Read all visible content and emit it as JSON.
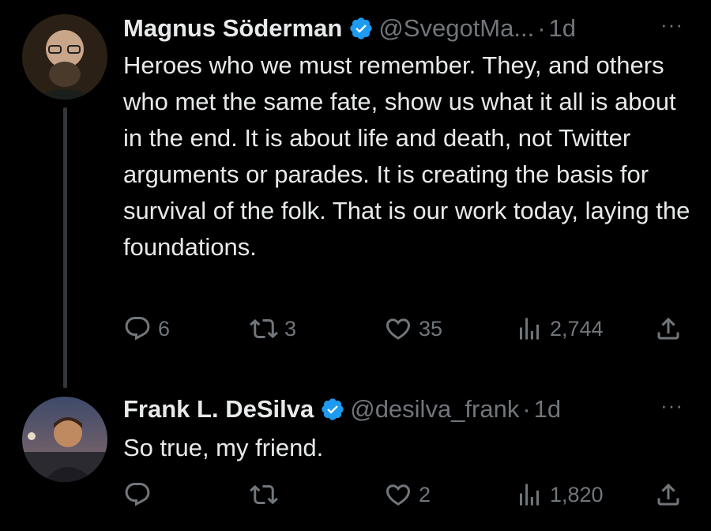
{
  "tweets": [
    {
      "author_name": "Magnus Söderman",
      "handle": "@SvegotMa...",
      "separator": "·",
      "time": "1d",
      "more": "···",
      "text": "Heroes who we must remember. They, and others who met the same fate, show us what it all is about in the end. It is about life and death, not Twitter arguments or parades. It is creating the basis for survival of the folk. That is our work today, laying the foundations.",
      "replies": "6",
      "retweets": "3",
      "likes": "35",
      "views": "2,744"
    },
    {
      "author_name": "Frank L. DeSilva",
      "handle": "@desilva_frank",
      "separator": "·",
      "time": "1d",
      "more": "···",
      "text": "So true, my friend.",
      "replies": "",
      "retweets": "",
      "likes": "2",
      "views": "1,820"
    }
  ],
  "colors": {
    "background": "#000000",
    "text_primary": "#e7e9ea",
    "text_secondary": "#71767b",
    "verified_badge": "#1d9bf0"
  },
  "icons": [
    "verified-badge-icon",
    "reply-icon",
    "retweet-icon",
    "like-icon",
    "views-icon",
    "share-icon"
  ]
}
